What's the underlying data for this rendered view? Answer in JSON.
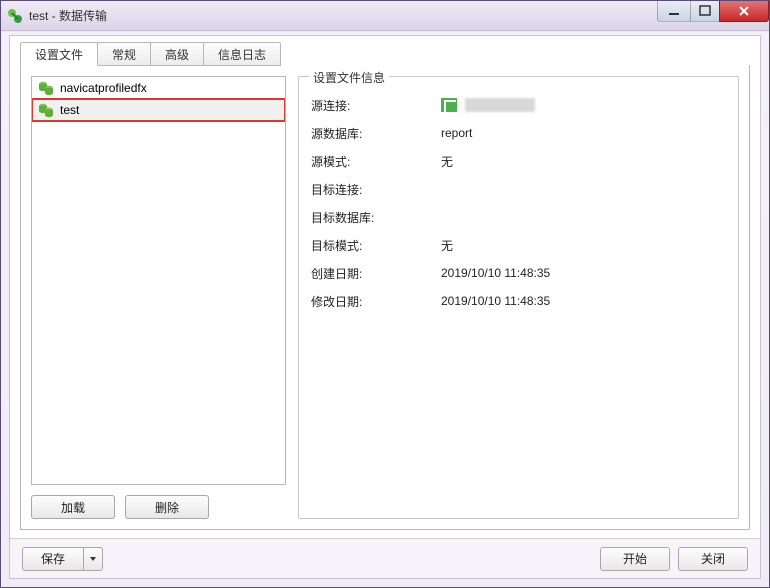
{
  "window": {
    "title": "test - 数据传输"
  },
  "tabs": [
    {
      "label": "设置文件",
      "active": true
    },
    {
      "label": "常规",
      "active": false
    },
    {
      "label": "高级",
      "active": false
    },
    {
      "label": "信息日志",
      "active": false
    }
  ],
  "profiles": [
    {
      "name": "navicatprofiledfx",
      "selected": false
    },
    {
      "name": "test",
      "selected": true
    }
  ],
  "left_buttons": {
    "load": "加载",
    "delete": "删除"
  },
  "info": {
    "group_title": "设置文件信息",
    "rows": [
      {
        "label": "源连接:",
        "value": "",
        "type": "conn"
      },
      {
        "label": "源数据库:",
        "value": "report"
      },
      {
        "label": "源模式:",
        "value": "无"
      },
      {
        "label": "目标连接:",
        "value": ""
      },
      {
        "label": "目标数据库:",
        "value": ""
      },
      {
        "label": "目标模式:",
        "value": "无"
      },
      {
        "label": "创建日期:",
        "value": "2019/10/10 11:48:35"
      },
      {
        "label": "修改日期:",
        "value": "2019/10/10 11:48:35"
      }
    ]
  },
  "bottom": {
    "save": "保存",
    "start": "开始",
    "close": "关闭"
  }
}
